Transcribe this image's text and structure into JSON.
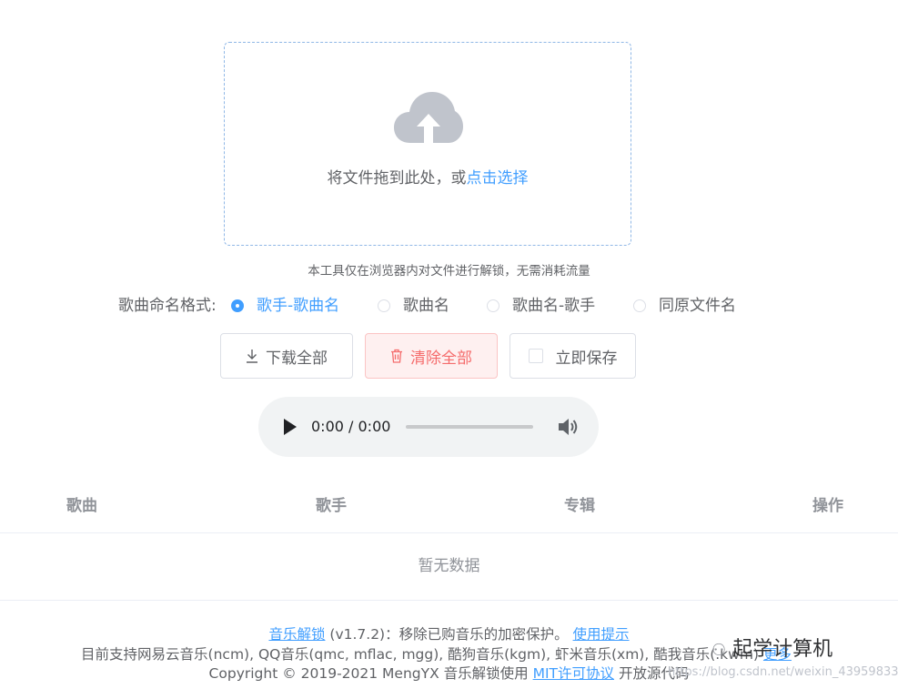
{
  "upload": {
    "hint_text": "将文件拖到此处，或",
    "hint_link": "点击选择",
    "tip": "本工具仅在浏览器内对文件进行解锁，无需消耗流量"
  },
  "naming": {
    "label": "歌曲命名格式:",
    "options": [
      "歌手-歌曲名",
      "歌曲名",
      "歌曲名-歌手",
      "同原文件名"
    ],
    "selected": "歌手-歌曲名"
  },
  "actions": {
    "download_all": "下载全部",
    "clear_all": "清除全部",
    "save_now": "立即保存"
  },
  "player": {
    "time": "0:00 / 0:00"
  },
  "table": {
    "columns": [
      "歌曲",
      "歌手",
      "专辑",
      "操作"
    ],
    "empty_text": "暂无数据"
  },
  "footer": {
    "line1_link": "音乐解锁",
    "line1_text": "(v1.7.2)：移除已购音乐的加密保护。",
    "line1_help": "使用提示",
    "line2_text": "目前支持网易云音乐(ncm), QQ音乐(qmc, mflac, mgg), 酷狗音乐(kgm), 虾米音乐(xm), 酷我音乐(.kwm)",
    "line2_more": "更多",
    "line3_text": "Copyright © 2019-2021 MengYX 音乐解锁使用",
    "line3_license": "MIT许可协议",
    "line3_tail": "开放源代码"
  },
  "watermark": {
    "title": "起学计算机",
    "url": "https://blog.csdn.net/weixin_43959833"
  },
  "colors": {
    "accent": "#409eff",
    "danger": "#f56c6c",
    "muted": "#909399"
  }
}
